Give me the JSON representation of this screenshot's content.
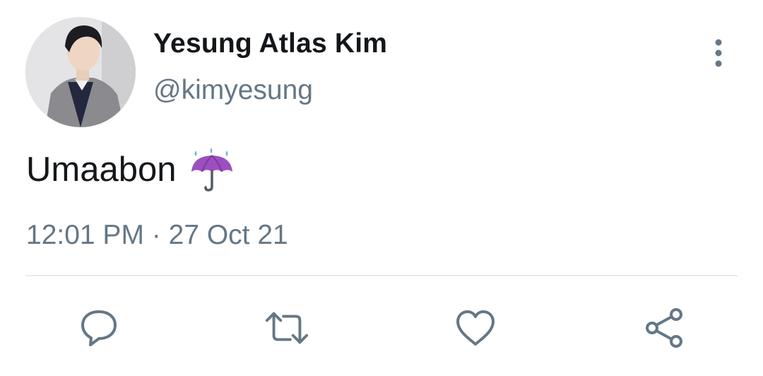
{
  "author": {
    "display_name": "Yesung Atlas Kim",
    "handle": "@kimyesung",
    "avatar_icon": "profile-photo"
  },
  "tweet": {
    "text": "Umaabon",
    "emoji_icon": "umbrella-with-rain-drops-icon",
    "time": "12:01 PM",
    "separator": "·",
    "date": "27 Oct 21"
  },
  "actions": [
    "reply-icon",
    "retweet-icon",
    "like-icon",
    "share-icon"
  ],
  "colors": {
    "text_primary": "#14171a",
    "text_secondary": "#657786",
    "divider": "#e6ecf0",
    "icon": "#657786",
    "emoji_umbrella": "#9c4fbf"
  }
}
